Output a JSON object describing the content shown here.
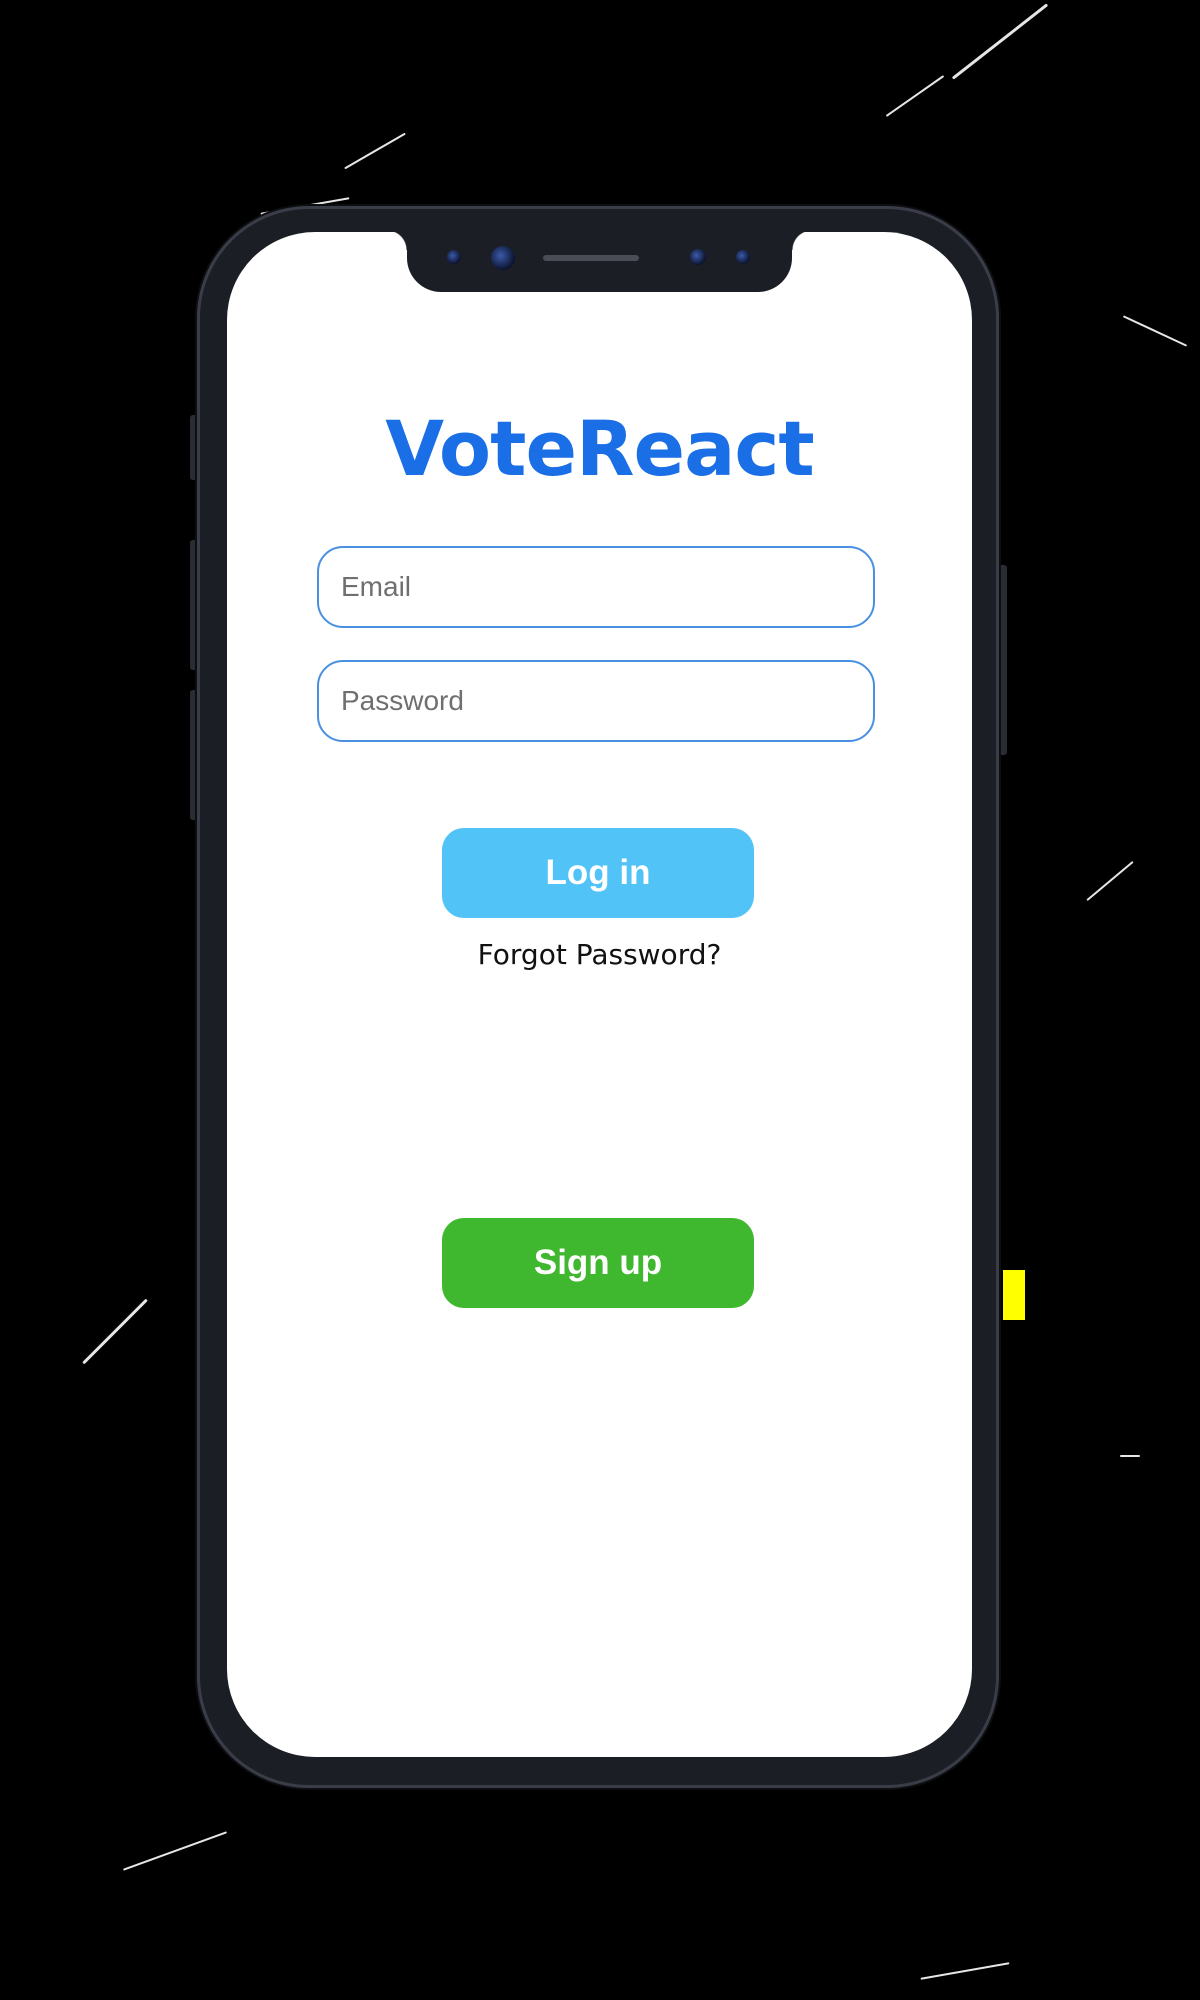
{
  "app": {
    "title": "VoteReact"
  },
  "login_form": {
    "email": {
      "placeholder": "Email",
      "value": ""
    },
    "password": {
      "placeholder": "Password",
      "value": ""
    },
    "login_label": "Log in",
    "forgot_password_label": "Forgot Password?",
    "signup_label": "Sign up"
  },
  "colors": {
    "title": "#1a6ee6",
    "input_border": "#4a90e2",
    "login_button": "#52c3f7",
    "signup_button": "#3fb72e",
    "phone_frame": "#1c1e26"
  }
}
